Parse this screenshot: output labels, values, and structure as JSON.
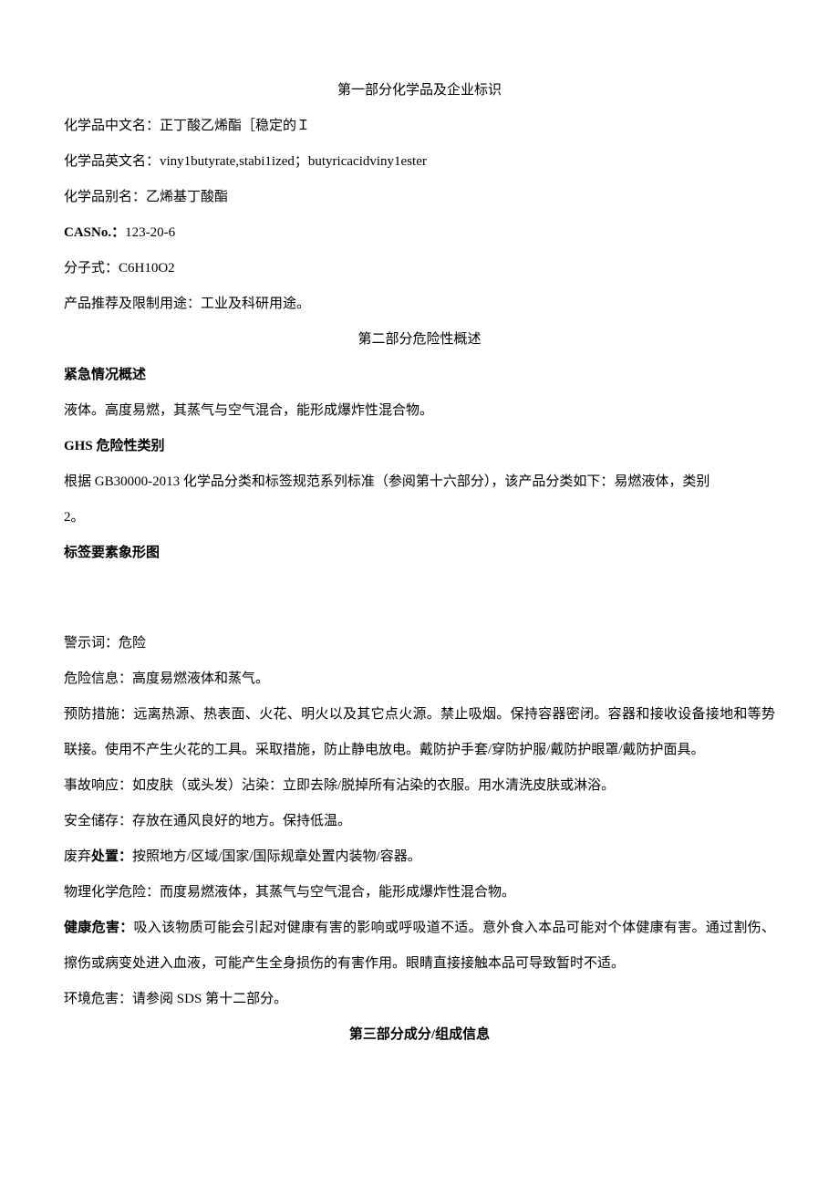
{
  "sections": {
    "s1": {
      "title": "第一部分化学品及企业标识",
      "lines": {
        "cn_name_label": "化学品中文名：",
        "cn_name_value": "正丁酸乙烯酯［稳定的Ｉ",
        "en_name_label": "化学品英文名：",
        "en_name_value": "viny1butyrate,stabi1ized；butyricacidviny1ester",
        "alias_label": "化学品别名：",
        "alias_value": "乙烯基丁酸酯",
        "cas_label": "CASNo.：",
        "cas_value": "123-20-6",
        "formula_label": "分子式：",
        "formula_value": "C6H10O2",
        "usage_label": "产品推荐及限制用途：",
        "usage_value": "工业及科研用途。"
      }
    },
    "s2": {
      "title": "第二部分危险性概述",
      "emergency_heading": "紧急情况概述",
      "emergency_text": "液体。高度易燃，其蒸气与空气混合，能形成爆炸性混合物。",
      "ghs_heading_prefix": "GHS",
      "ghs_heading_rest": " 危险性类别",
      "ghs_text_1": "根据 ",
      "ghs_text_2": "GB30000-2013",
      "ghs_text_3": " 化学品分类和标签规范系列标准（参阅第十六部分），该产品分类如下：易燃液体，类别",
      "ghs_text_4": "2。",
      "pictogram_heading": "标签要素象形图",
      "signal_label": "警示词：",
      "signal_value": "危险",
      "hazard_label": "危险信息：",
      "hazard_value": "高度易燃液体和蒸气。",
      "prevent_label": "预防措施：",
      "prevent_value": "远离热源、热表面、火花、明火以及其它点火源。禁止吸烟。保持容器密闭。容器和接收设备接地和等势联接。使用不产生火花的工具。采取措施，防止静电放电。戴防护手套/穿防护服/戴防护眼罩/戴防护面具。",
      "response_label": "事故响应：",
      "response_value": "如皮肤（或头发）沾染：立即去除/脱掉所有沾染的衣服。用水清洗皮肤或淋浴。",
      "storage_label": "安全储存：",
      "storage_value": "存放在通风良好的地方。保持低温。",
      "disposal_prefix": "废弃",
      "disposal_bold": "处置：",
      "disposal_value": "按照地方/区域/国家/国际规章处置内装物/容器。",
      "physchem_label": "物理化学危险：",
      "physchem_value": "而度易燃液体，其蒸气与空气混合，能形成爆炸性混合物。",
      "health_label": "健康危害：",
      "health_value": "吸入该物质可能会引起对健康有害的影响或呼吸道不适。意外食入本品可能对个体健康有害。通过割伤、擦伤或病变处进入血液，可能产生全身损伤的有害作用。眼睛直接接触本品可导致暂时不适。",
      "env_label": "环境危害：",
      "env_value_1": "请参阅 ",
      "env_value_2": "SDS",
      "env_value_3": " 第十二部分。"
    },
    "s3": {
      "title": "第三部分成分/组成信息"
    }
  }
}
